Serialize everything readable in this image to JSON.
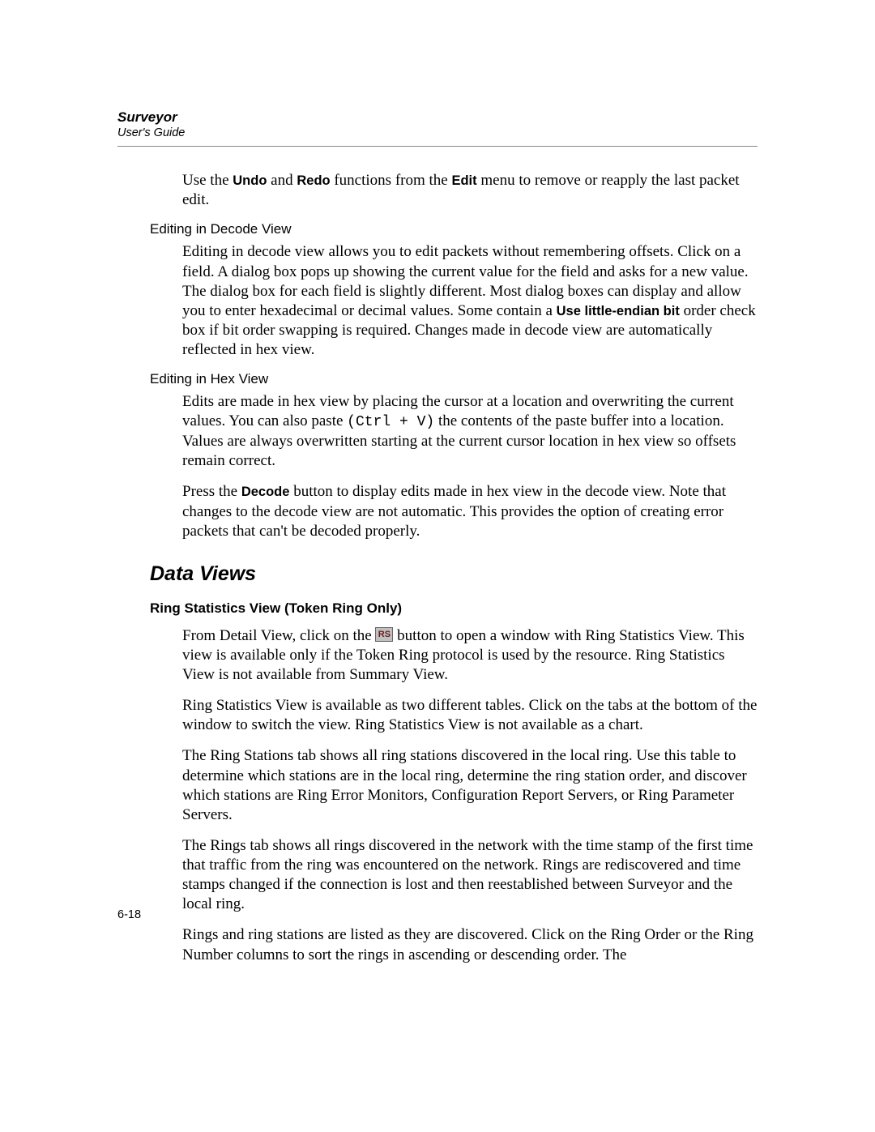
{
  "header": {
    "title": "Surveyor",
    "subtitle": "User's Guide"
  },
  "intro": {
    "text_before_undo": "Use the ",
    "undo": "Undo",
    "text_mid1": " and ",
    "redo": "Redo",
    "text_mid2": " functions from the ",
    "edit": "Edit",
    "text_after": " menu to remove or reapply the last packet edit."
  },
  "decode_view": {
    "heading": "Editing in Decode View",
    "p1_before": "Editing in decode view allows you to edit packets without remembering offsets. Click on a field. A dialog box pops up showing the current value for the field and asks for a new value. The dialog box for each field is slightly different. Most dialog boxes can display and allow you to enter hexadecimal or decimal values. Some contain a ",
    "little_endian": "Use little-endian bit",
    "p1_after": " order check box if bit order swapping is required. Changes made in decode view are automatically reflected in hex view."
  },
  "hex_view": {
    "heading": "Editing in Hex View",
    "p1_before": "Edits are made in hex view by placing the cursor at a location and overwriting the current values. You can also paste ",
    "ctrl_v": "(Ctrl + V)",
    "p1_after": " the contents of the paste buffer into a location. Values are always overwritten starting at the current cursor location in hex view so offsets remain correct.",
    "p2_before": "Press the ",
    "decode": "Decode",
    "p2_after": " button to display edits made in hex view in the decode view. Note that changes to the decode view are not automatic. This provides the option of creating error packets that can't be decoded properly."
  },
  "data_views": {
    "heading": "Data Views",
    "ring_stats_heading": "Ring Statistics View (Token Ring Only)",
    "p1_before": "From Detail View, click on the ",
    "icon_label": "RS",
    "p1_after": " button to open a window with Ring Statistics View. This view is available only if the Token Ring protocol is used by the resource. Ring Statistics View is not available from Summary View.",
    "p2": "Ring Statistics View is available as two different tables. Click on the tabs at the bottom of the window to switch the view. Ring Statistics View is not available as a chart.",
    "p3": "The Ring Stations tab shows all ring stations discovered in the local ring. Use this table to determine which stations are in the local ring, determine the ring station order, and discover which stations are Ring Error Monitors, Configuration Report Servers, or Ring Parameter Servers.",
    "p4": "The Rings tab shows all rings discovered in the network with the time stamp of the first time that traffic from the ring was encountered on the network. Rings are rediscovered and time stamps changed if the connection is lost and then reestablished between Surveyor and the local ring.",
    "p5": "Rings and ring stations are listed as they are discovered. Click on the Ring Order or the Ring Number columns to sort the rings in ascending or descending order. The"
  },
  "page_number": "6-18"
}
